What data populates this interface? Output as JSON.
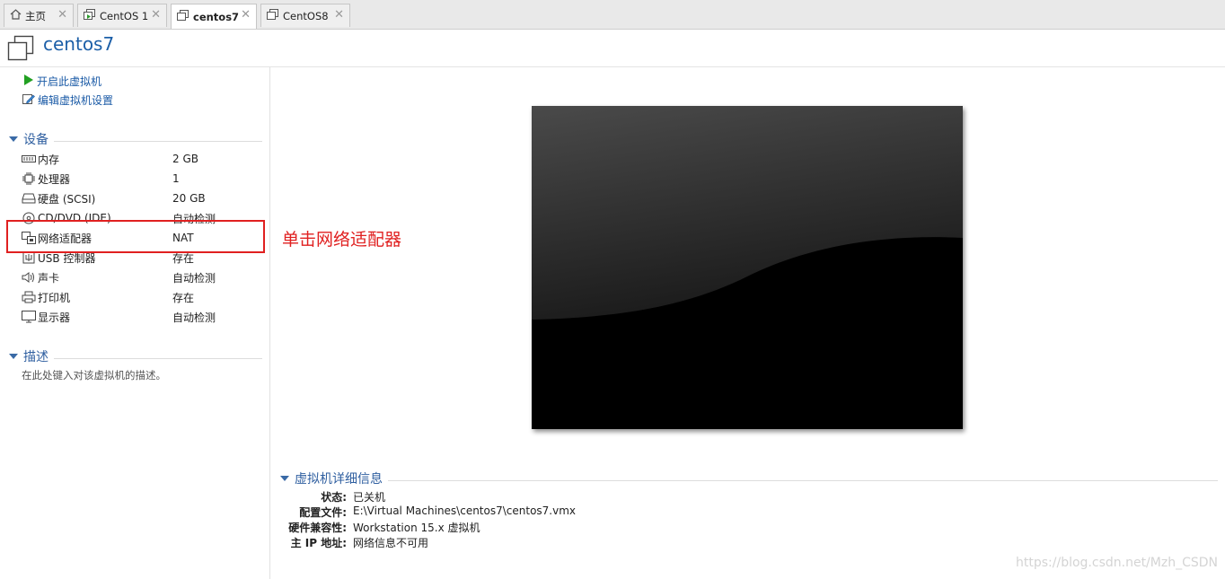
{
  "tabs": [
    {
      "label": "主页",
      "icon": "home-icon",
      "active": false
    },
    {
      "label": "CentOS 1",
      "icon": "vm-running-icon",
      "active": false
    },
    {
      "label": "centos7",
      "icon": "vm-icon",
      "active": true
    },
    {
      "label": "CentOS8",
      "icon": "vm-icon",
      "active": false
    }
  ],
  "page_title": "centos7",
  "actions": [
    {
      "label": "开启此虚拟机",
      "icon": "play-icon"
    },
    {
      "label": "编辑虚拟机设置",
      "icon": "edit-settings-icon"
    }
  ],
  "devices_section": {
    "title": "设备",
    "items": [
      {
        "name": "内存",
        "value": "2 GB",
        "icon": "memory-icon"
      },
      {
        "name": "处理器",
        "value": "1",
        "icon": "cpu-icon"
      },
      {
        "name": "硬盘 (SCSI)",
        "value": "20 GB",
        "icon": "harddisk-icon"
      },
      {
        "name": "CD/DVD (IDE)",
        "value": "自动检测",
        "icon": "cd-dvd-icon"
      },
      {
        "name": "网络适配器",
        "value": "NAT",
        "icon": "network-adapter-icon"
      },
      {
        "name": "USB 控制器",
        "value": "存在",
        "icon": "usb-icon"
      },
      {
        "name": "声卡",
        "value": "自动检测",
        "icon": "sound-icon"
      },
      {
        "name": "打印机",
        "value": "存在",
        "icon": "printer-icon"
      },
      {
        "name": "显示器",
        "value": "自动检测",
        "icon": "display-icon"
      }
    ]
  },
  "description_section": {
    "title": "描述",
    "placeholder": "在此处键入对该虚拟机的描述。"
  },
  "annotation": "单击网络适配器",
  "details_section": {
    "title": "虚拟机详细信息",
    "rows": [
      {
        "label": "状态:",
        "value": "已关机"
      },
      {
        "label": "配置文件:",
        "value": "E:\\Virtual Machines\\centos7\\centos7.vmx"
      },
      {
        "label": "硬件兼容性:",
        "value": "Workstation 15.x 虚拟机"
      },
      {
        "label": "主 IP 地址:",
        "value": "网络信息不可用"
      }
    ]
  },
  "watermark": "https://blog.csdn.net/Mzh_CSDN",
  "colors": {
    "link": "#1a5aa6",
    "section_title": "#2f5fa0",
    "annotation": "#e02020"
  }
}
